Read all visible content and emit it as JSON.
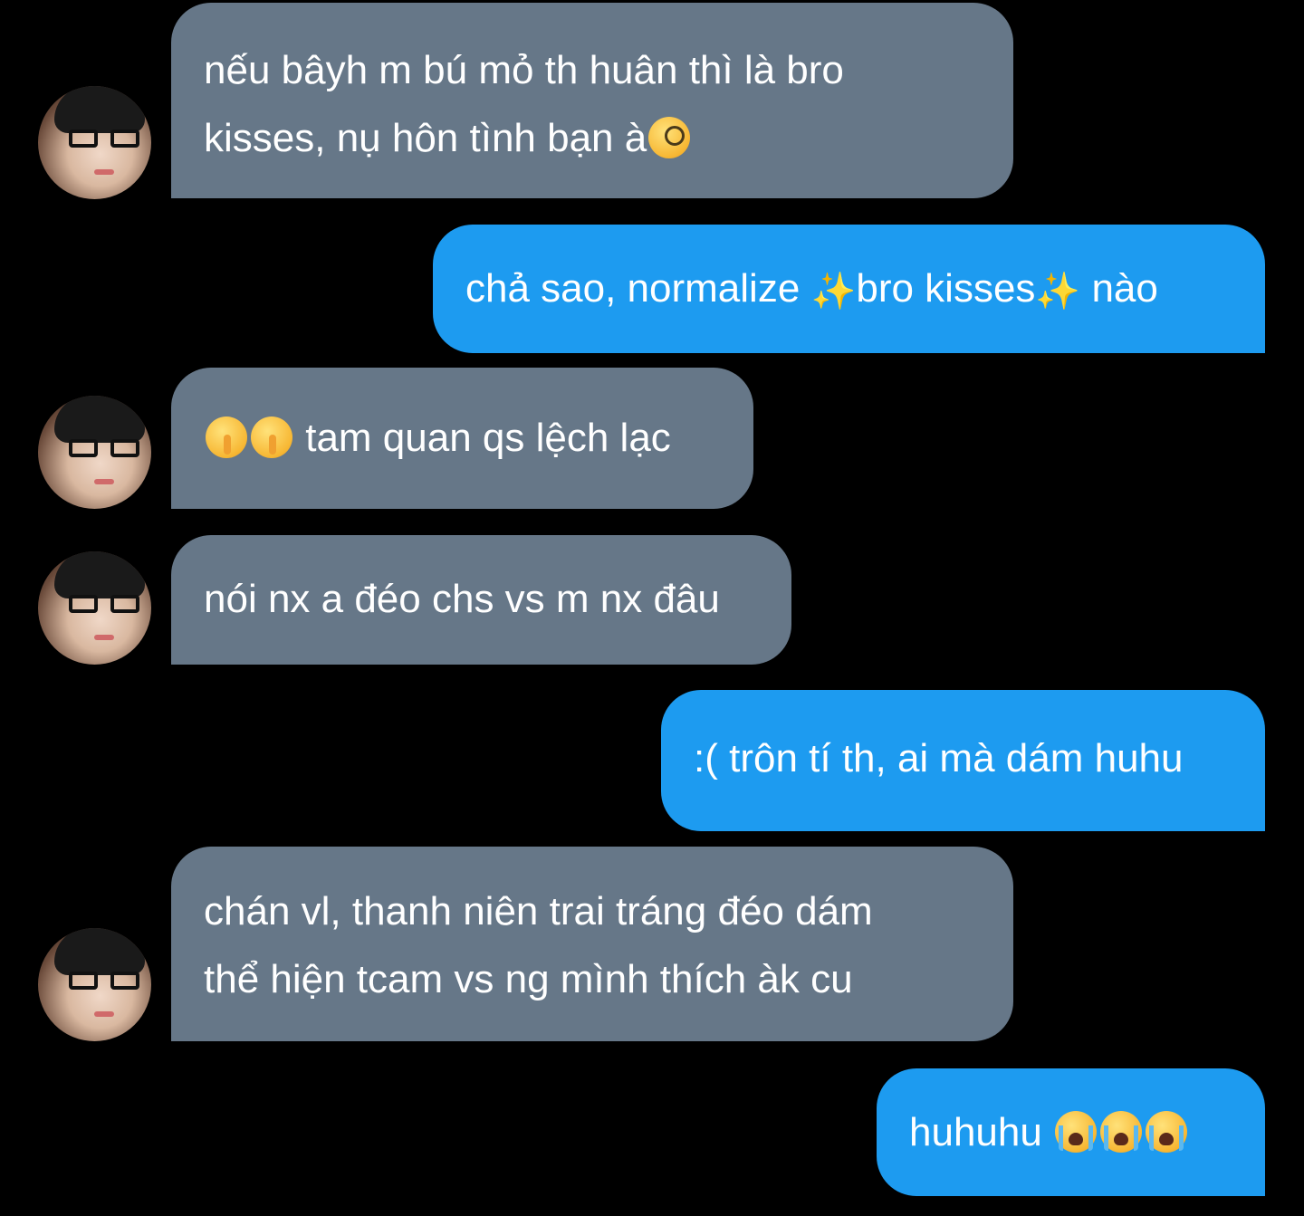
{
  "messages": [
    {
      "sender": "them",
      "lines": [
        "nếu bâyh m bú mỏ th huân thì là bro",
        "kisses, nụ hôn tình bạn à"
      ],
      "emoji": "face-with-monocle"
    },
    {
      "sender": "me",
      "text_a": "chả sao, normalize ",
      "text_b": "bro kisses",
      "text_c": " nào",
      "emoji": "sparkles"
    },
    {
      "sender": "them",
      "text": " tam quan qs lệch lạc",
      "emoji": "shushing-face"
    },
    {
      "sender": "them",
      "text": "nói nx a đéo chs vs m nx đâu"
    },
    {
      "sender": "me",
      "text": ":( trôn tí th, ai mà dám huhu"
    },
    {
      "sender": "them",
      "lines": [
        "chán vl, thanh niên trai tráng đéo dám",
        "thể hiện tcam vs ng mình thích àk cu"
      ]
    },
    {
      "sender": "me",
      "text": "huhuhu ",
      "emoji": "loudly-crying-face"
    }
  ],
  "colors": {
    "background": "#000000",
    "received_bubble": "#667788",
    "sent_bubble": "#1d9bf0",
    "text": "#ffffff"
  }
}
